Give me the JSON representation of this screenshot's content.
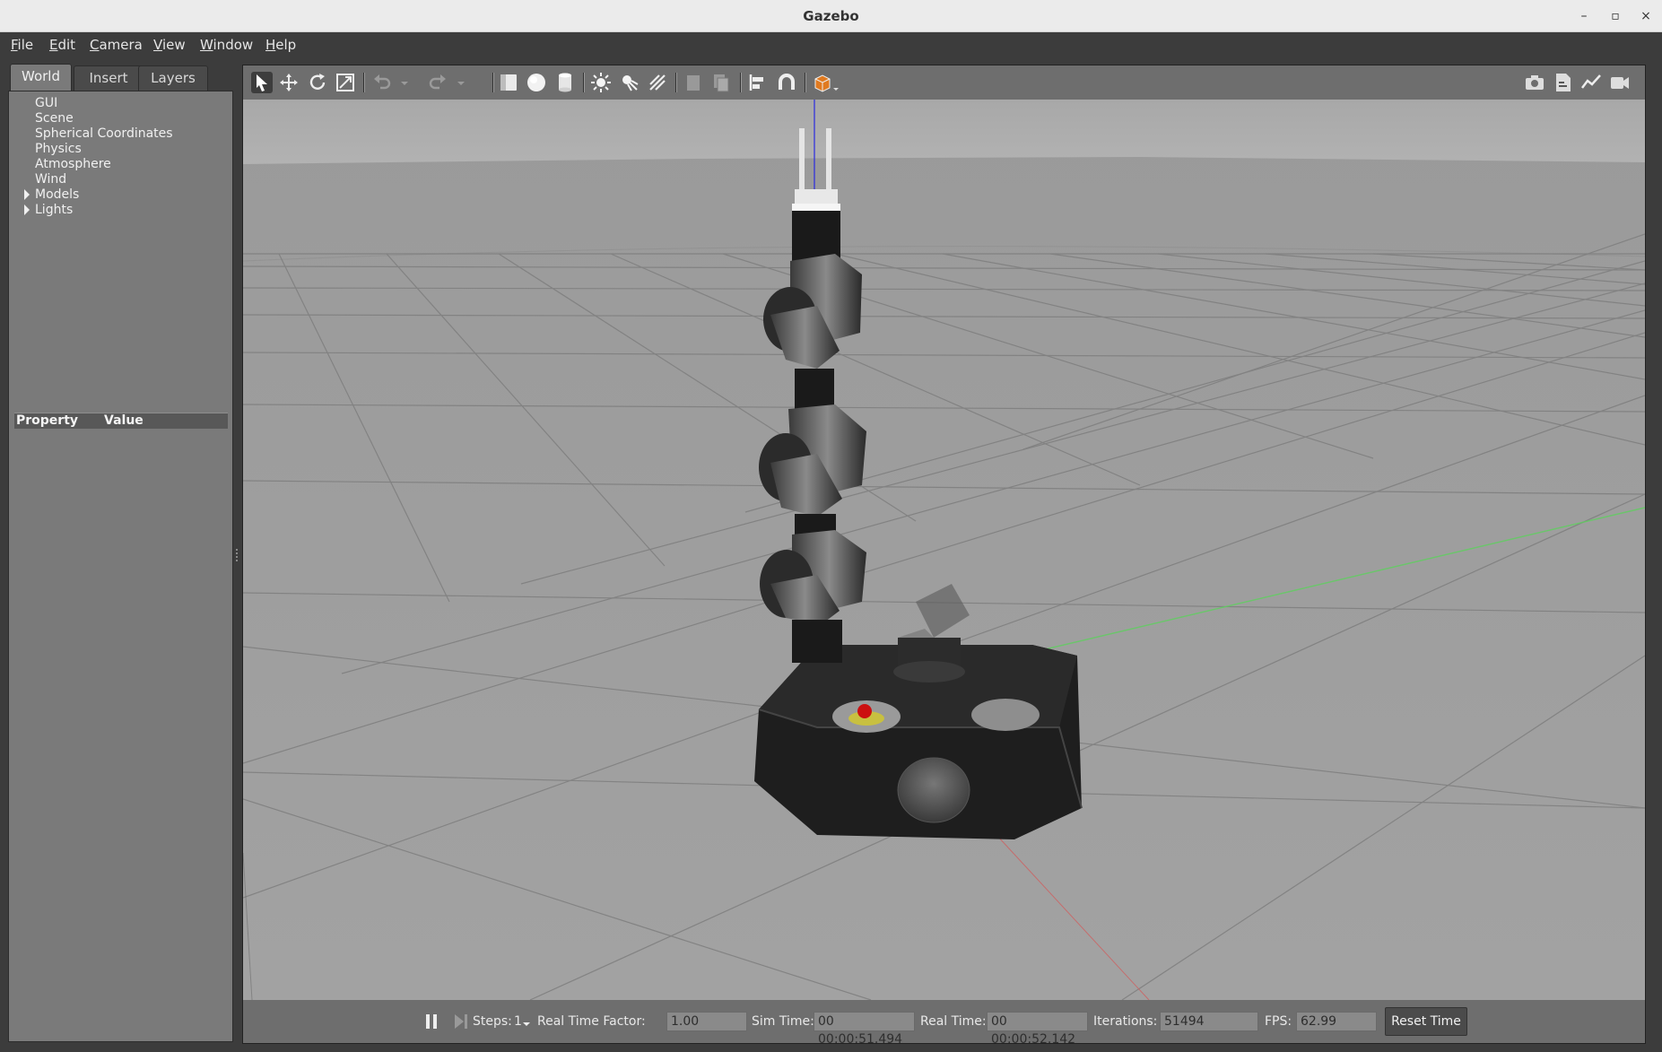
{
  "window": {
    "title": "Gazebo"
  },
  "menu": [
    {
      "key": "F",
      "rest": "ile"
    },
    {
      "key": "E",
      "rest": "dit"
    },
    {
      "key": "C",
      "rest": "amera"
    },
    {
      "key": "V",
      "rest": "iew"
    },
    {
      "key": "W",
      "rest": "indow"
    },
    {
      "key": "H",
      "rest": "elp"
    }
  ],
  "tabs": [
    "World",
    "Insert",
    "Layers"
  ],
  "active_tab": "World",
  "tree": {
    "items": [
      "GUI",
      "Scene",
      "Spherical Coordinates",
      "Physics",
      "Atmosphere",
      "Wind",
      "Models",
      "Lights"
    ],
    "expandable": [
      "Models",
      "Lights"
    ]
  },
  "properties": {
    "col_property": "Property",
    "col_value": "Value"
  },
  "toolbar": {
    "left_icons": [
      "select-icon",
      "translate-icon",
      "rotate-icon",
      "scale-icon",
      "undo-icon",
      "undo-dropdown-icon",
      "redo-icon",
      "redo-dropdown-icon",
      "box-icon",
      "sphere-icon",
      "cylinder-icon",
      "point-light-icon",
      "spot-light-icon",
      "directional-light-icon",
      "copy-icon",
      "paste-icon",
      "align-icon",
      "snap-icon",
      "change-view-icon"
    ],
    "right_icons": [
      "screenshot-icon",
      "log-icon",
      "plot-icon",
      "video-record-icon"
    ]
  },
  "status": {
    "steps_label": "Steps:",
    "steps_value": "1",
    "rtf_label": "Real Time Factor:",
    "rtf_value": "1.00",
    "sim_time_label": "Sim Time:",
    "sim_time_value": "00 00:00:51.494",
    "real_time_label": "Real Time:",
    "real_time_value": "00 00:00:52.142",
    "iterations_label": "Iterations:",
    "iterations_value": "51494",
    "fps_label": "FPS:",
    "fps_value": "62.99",
    "reset_label": "Reset Time"
  },
  "colors": {
    "sky_top": "#b4b4b4",
    "ground": "#9a9a9a",
    "grid_line": "#7e7e7e",
    "panel_bg": "#7a7a7a",
    "toolbar_bg": "#6e6e6e",
    "robot_dark": "#1e1e1e",
    "emergency_button": "#cc1010",
    "y_axis": "#5fcf5f",
    "x_axis": "#cf5f5f",
    "z_axis": "#2a2adf"
  }
}
